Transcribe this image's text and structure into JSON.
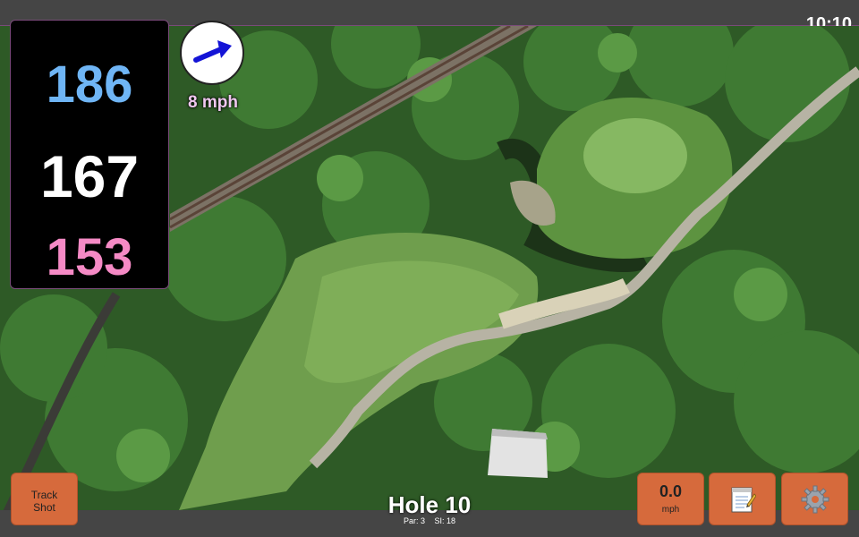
{
  "status_bar": {
    "time": "10:10"
  },
  "yardages": {
    "back": "186",
    "middle": "167",
    "front": "153"
  },
  "wind": {
    "speed_label": "8 mph",
    "direction_icon": "arrow-icon"
  },
  "hole": {
    "title": "Hole 10",
    "par": "Par: 3",
    "stroke_index": "SI: 18"
  },
  "buttons": {
    "track_shot_line1": "Track",
    "track_shot_line2": "Shot",
    "wind_value": "0.0",
    "wind_unit": "mph",
    "notes_icon": "notepad-icon",
    "settings_icon": "gear-icon"
  },
  "colors": {
    "back_yardage": "#6fb5f5",
    "middle_yardage": "#ffffff",
    "front_yardage": "#f58ac5",
    "button": "#d66a3c",
    "wind_arrow": "#1414d6"
  }
}
